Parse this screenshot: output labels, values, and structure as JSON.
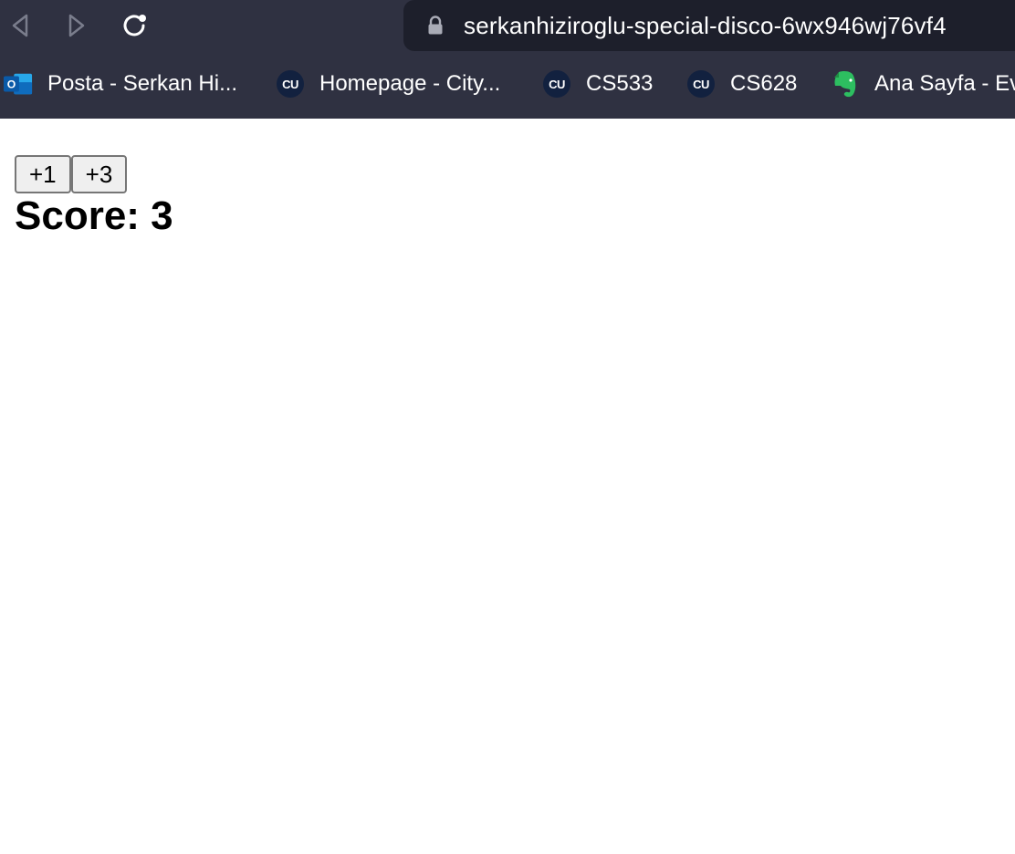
{
  "browser": {
    "url": "serkanhiziroglu-special-disco-6wx946wj76vf4",
    "bookmarks": [
      {
        "label": "Posta - Serkan Hi...",
        "icon": "outlook-icon"
      },
      {
        "label": "Homepage - City...",
        "icon": "cu-icon"
      },
      {
        "label": "CS533",
        "icon": "cu-icon"
      },
      {
        "label": "CS628",
        "icon": "cu-icon"
      },
      {
        "label": "Ana Sayfa - Ev",
        "icon": "evernote-icon"
      }
    ],
    "cu_badge": "CU",
    "outlook_badge": "O",
    "colors": {
      "chrome_bg": "#2f3141",
      "address_bg": "#1d1f2b",
      "outlook_blue": "#0f6cbd",
      "evernote_green": "#2dbe60"
    }
  },
  "page": {
    "buttons": [
      {
        "label": "+1"
      },
      {
        "label": "+3"
      }
    ],
    "score_text": "Score: 3"
  }
}
